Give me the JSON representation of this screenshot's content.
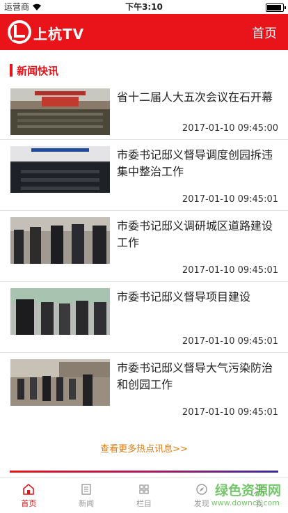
{
  "status_bar": {
    "carrier": "运营商",
    "time": "下午3:10"
  },
  "header": {
    "app_name": "上杭TV",
    "home_label": "首页"
  },
  "section": {
    "title": "新闻快讯"
  },
  "news": [
    {
      "title": "省十二届人大五次会议在石开幕",
      "date": "2017-01-10 09:45:00"
    },
    {
      "title": "市委书记邸义督导调度创园拆违集中整治工作",
      "date": "2017-01-10 09:45:01"
    },
    {
      "title": "市委书记邸义调研城区道路建设工作",
      "date": "2017-01-10 09:45:01"
    },
    {
      "title": "市委书记邸义督导项目建设",
      "date": "2017-01-10 09:45:01"
    },
    {
      "title": "市委书记邸义督导大气污染防治和创园工作",
      "date": "2017-01-10 09:45:01"
    }
  ],
  "more_link": "查看更多热点讯息>>",
  "tabs": [
    {
      "label": "首页",
      "icon": "home-icon"
    },
    {
      "label": "新闻",
      "icon": "news-icon"
    },
    {
      "label": "栏目",
      "icon": "grid-icon"
    },
    {
      "label": "发现",
      "icon": "compass-icon"
    },
    {
      "label": "我",
      "icon": "user-icon"
    }
  ],
  "watermark": {
    "text": "绿色资源网",
    "url": "www.downcc.com"
  },
  "colors": {
    "brand": "#e8141a",
    "more_link": "#e07a10"
  }
}
